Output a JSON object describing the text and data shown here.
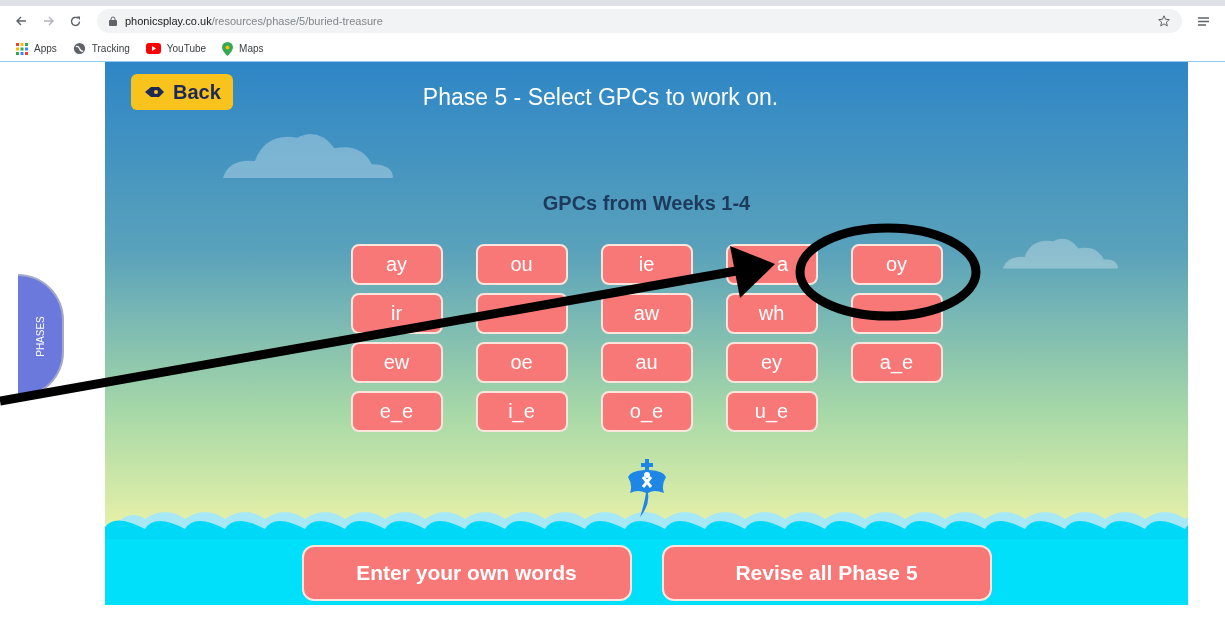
{
  "browser": {
    "url_host": "phonicsplay.co.uk",
    "url_path": "/resources/phase/5/buried-treasure",
    "bookmarks": [
      {
        "kind": "apps",
        "label": "Apps"
      },
      {
        "kind": "globe",
        "label": "Tracking"
      },
      {
        "kind": "youtube",
        "label": "YouTube"
      },
      {
        "kind": "maps",
        "label": "Maps"
      }
    ]
  },
  "game": {
    "back_button": "Back",
    "title": "Phase 5 - Select GPCs to work on.",
    "section_title": "GPCs from Weeks 1-4",
    "phases_tab": "PHASES",
    "gpcs": [
      {
        "kind": "text",
        "label": "ay"
      },
      {
        "kind": "text",
        "label": "ou"
      },
      {
        "kind": "text",
        "label": "ie"
      },
      {
        "kind": "tail",
        "label": "a"
      },
      {
        "kind": "text",
        "label": "oy"
      },
      {
        "kind": "text",
        "label": "ir"
      },
      {
        "kind": "covered"
      },
      {
        "kind": "text",
        "label": "aw"
      },
      {
        "kind": "text",
        "label": "wh"
      },
      {
        "kind": "covered"
      },
      {
        "kind": "text",
        "label": "ew"
      },
      {
        "kind": "text",
        "label": "oe"
      },
      {
        "kind": "text",
        "label": "au"
      },
      {
        "kind": "text",
        "label": "ey"
      },
      {
        "kind": "text",
        "label": "a_e"
      },
      {
        "kind": "text",
        "label": "e_e"
      },
      {
        "kind": "text",
        "label": "i_e"
      },
      {
        "kind": "text",
        "label": "o_e"
      },
      {
        "kind": "text",
        "label": "u_e"
      }
    ],
    "bottom_buttons": [
      "Enter your own words",
      "Revise all Phase 5"
    ]
  }
}
